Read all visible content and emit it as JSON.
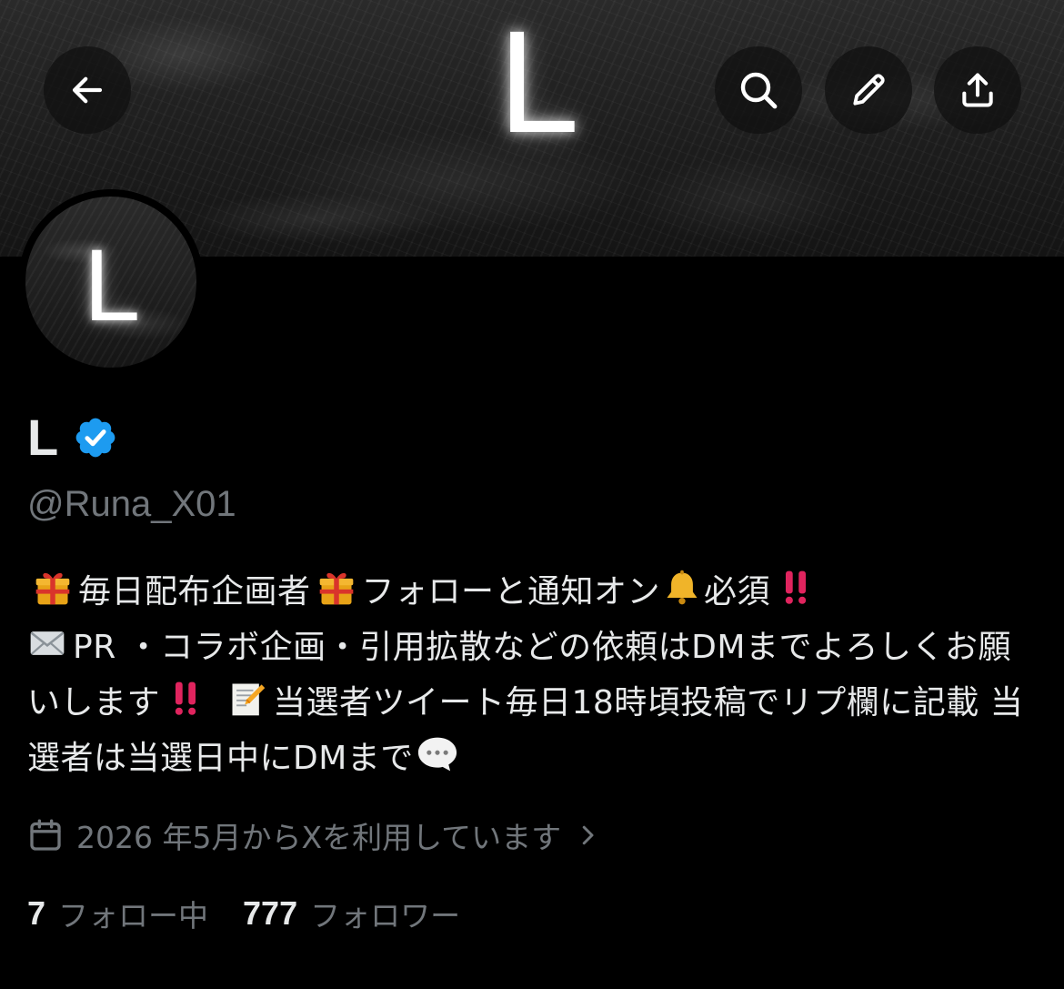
{
  "banner": {
    "letter": "L"
  },
  "toolbar": {
    "back_icon": "arrow-left-icon",
    "search_icon": "search-icon",
    "edit_icon": "pencil-icon",
    "share_icon": "share-icon"
  },
  "avatar": {
    "letter": "L"
  },
  "profile": {
    "display_name": "L",
    "verified_badge_color": "#1d9bf0",
    "handle": "@Runa_X01"
  },
  "bio": {
    "segments": {
      "gift1": "gift-emoji",
      "t1": "毎日配布企画者",
      "gift2": "gift-emoji",
      "t2": "フォローと通知オン",
      "bell": "bell-emoji",
      "t3": "必須",
      "bang1": "double-exclamation-emoji",
      "envelope": "envelope-emoji",
      "t4": "PR ・コラボ企画・引用拡散などの依頼はDMまでよろしくお願いします",
      "bang2": "double-exclamation-emoji",
      "memo": "memo-emoji",
      "t5": "当選者ツイート毎日18時頃投稿でリプ欄に記載 当選者は当選日中にDMまで",
      "speech": "speech-balloon-emoji"
    }
  },
  "joined": {
    "icon": "calendar-icon",
    "text": "2026 年5月からXを利用しています",
    "chevron": "chevron-right-icon"
  },
  "stats": {
    "following_count": "7",
    "following_label": "フォロー中",
    "followers_count": "777",
    "followers_label": "フォロワー"
  },
  "colors": {
    "background": "#000000",
    "text_primary": "#e7e9ea",
    "text_secondary": "#71767b",
    "accent": "#1d9bf0",
    "alert_red": "#e0245e"
  }
}
